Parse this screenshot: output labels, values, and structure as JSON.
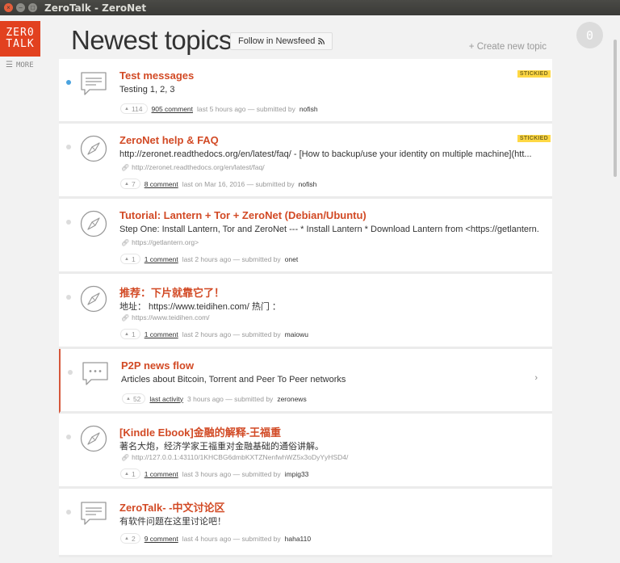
{
  "window": {
    "title": "ZeroTalk - ZeroNet"
  },
  "sidebar": {
    "logo_line1": "ZER0",
    "logo_line2": "TALK",
    "more_label": "MORE"
  },
  "header": {
    "title": "Newest topics",
    "follow_label": "Follow in Newsfeed",
    "create_label": "+ Create new topic",
    "user_initial": "0"
  },
  "topics": [
    {
      "title": "Test messages",
      "body": "Testing 1, 2, 3",
      "link": "",
      "votes": "114",
      "comments": "905 comment",
      "meta": "last 5 hours ago — submitted by",
      "user": "nofish",
      "sticky": "STICKIED",
      "icon": "chat-lines-icon",
      "active": true
    },
    {
      "title": "ZeroNet help & FAQ",
      "body": "http://zeronet.readthedocs.org/en/latest/faq/ - [How to backup/use your identity on multiple machine](htt...",
      "link": "http://zeronet.readthedocs.org/en/latest/faq/",
      "votes": "7",
      "comments": "8 comment",
      "meta": "last on Mar 16, 2016 — submitted by",
      "user": "nofish",
      "sticky": "STICKIED",
      "icon": "compass-icon"
    },
    {
      "title": "Tutorial: Lantern + Tor + ZeroNet (Debian/Ubuntu)",
      "body": "Step One: Install Lantern, Tor and ZeroNet --- * Install Lantern * Download Lantern from <https://getlantern....",
      "link": "https://getlantern.org>",
      "votes": "1",
      "comments": "1 comment",
      "meta": "last 2 hours ago — submitted by",
      "user": "onet",
      "icon": "compass-icon"
    },
    {
      "title": "推荐：下片就靠它了！",
      "body": "地址： https://www.teidihen.com/ 热门 ：",
      "link": "https://www.teidihen.com/",
      "votes": "1",
      "comments": "1 comment",
      "meta": "last 2 hours ago — submitted by",
      "user": "maiowu",
      "icon": "compass-icon"
    },
    {
      "title": "P2P news flow",
      "body": "Articles about Bitcoin, Torrent and Peer To Peer networks",
      "link": "",
      "votes": "52",
      "comments": "last activity",
      "meta": "3 hours ago — submitted by",
      "user": "zeronews",
      "icon": "chat-dots-icon",
      "feed": true,
      "chevron": "›"
    },
    {
      "title": "[Kindle Ebook]金融的解释-王福重",
      "body": "著名大炮，经济学家王福重对金融基础的通俗讲解。",
      "link": "http://127.0.0.1:43110/1KHCBG6dmbKXTZNenfwhWZ5x3oDyYyHSD4/",
      "votes": "1",
      "comments": "1 comment",
      "meta": "last 3 hours ago — submitted by",
      "user": "impig33",
      "icon": "compass-icon"
    },
    {
      "title": "ZeroTalk- -中文讨论区",
      "body": "有软件问题在这里讨论吧！",
      "link": "",
      "votes": "2",
      "comments": "9 comment",
      "meta": "last 4 hours ago — submitted by",
      "user": "haha110",
      "icon": "chat-lines-icon"
    }
  ],
  "colors": {
    "accent": "#d24a25",
    "logo": "#e2411f",
    "sticky": "#ffd844",
    "active_dot": "#4aa3df"
  }
}
